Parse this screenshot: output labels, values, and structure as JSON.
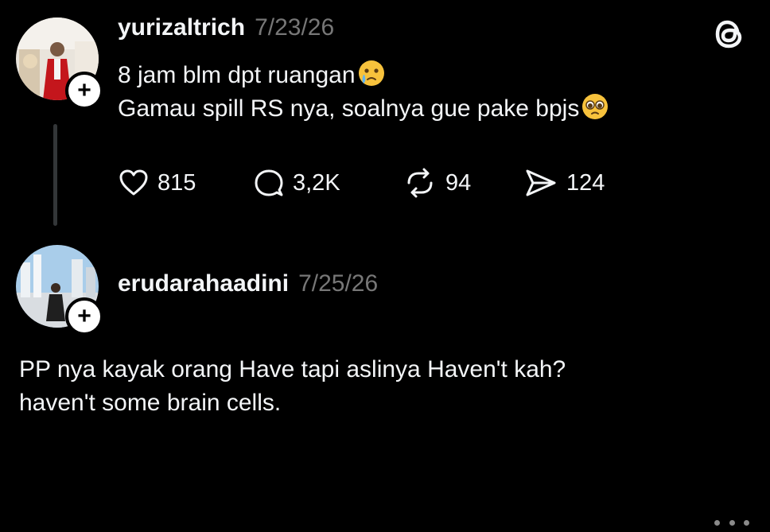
{
  "post1": {
    "username": "yurizaltrich",
    "date": "7/23/26",
    "line1": "8 jam blm dpt ruangan",
    "line1_emoji": "face-holding-back-tears-emoji",
    "line2": "Gamau spill RS nya, soalnya gue pake bpjs",
    "line2_emoji": "pleading-face-emoji",
    "follow_label": "+",
    "actions": {
      "likes": "815",
      "replies": "3,2K",
      "reposts": "94",
      "shares": "124"
    }
  },
  "post2": {
    "username": "erudarahaadini",
    "date": "7/25/26",
    "follow_label": "+",
    "line1": "PP nya kayak orang Have tapi aslinya Haven't kah?",
    "line2": "haven't some brain cells."
  },
  "icons": {
    "threads_logo": "threads-logo-icon",
    "more": "more-dots-icon",
    "like": "heart-icon",
    "reply": "comment-bubble-icon",
    "repost": "repost-arrows-icon",
    "share": "send-icon"
  },
  "colors": {
    "background": "#000000",
    "text": "#f3f5f7",
    "muted": "#777777",
    "thread_line": "#333638"
  }
}
